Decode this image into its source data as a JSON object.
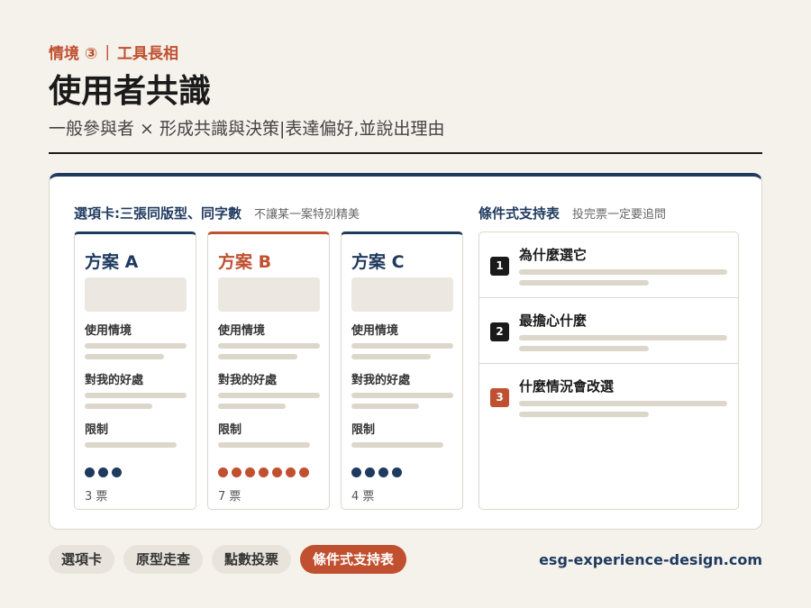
{
  "header": {
    "eyebrow_scenario": "情境 ③",
    "eyebrow_separator": "|",
    "eyebrow_topic": "工具長相",
    "title": "使用者共識",
    "subtitle": "一般參與者 × 形成共識與決策|表達偏好,並說出理由"
  },
  "left_section": {
    "heading": "選項卡:三張同版型、同字數",
    "note": "不讓某一案特別精美"
  },
  "cards": [
    {
      "name": "方案 A",
      "context_label": "使用情境",
      "benefit_label": "對我的好處",
      "limit_label": "限制",
      "votes": 3,
      "votes_label": "3 票",
      "accent": false
    },
    {
      "name": "方案 B",
      "context_label": "使用情境",
      "benefit_label": "對我的好處",
      "limit_label": "限制",
      "votes": 7,
      "votes_label": "7 票",
      "accent": true
    },
    {
      "name": "方案 C",
      "context_label": "使用情境",
      "benefit_label": "對我的好處",
      "limit_label": "限制",
      "votes": 4,
      "votes_label": "4 票",
      "accent": false
    }
  ],
  "right_section": {
    "heading": "條件式支持表",
    "note": "投完票一定要追問",
    "questions": [
      {
        "num": "1",
        "text": "為什麼選它"
      },
      {
        "num": "2",
        "text": "最擔心什麼"
      },
      {
        "num": "3",
        "text": "什麼情況會改選"
      }
    ]
  },
  "footer": {
    "tabs": [
      "選項卡",
      "原型走查",
      "點數投票",
      "條件式支持表"
    ],
    "active_tab": "條件式支持表",
    "site": "esg-experience-design.com"
  },
  "colors": {
    "accent": "#c0502f",
    "navy": "#1f3a5f",
    "background": "#f5f2ec"
  }
}
